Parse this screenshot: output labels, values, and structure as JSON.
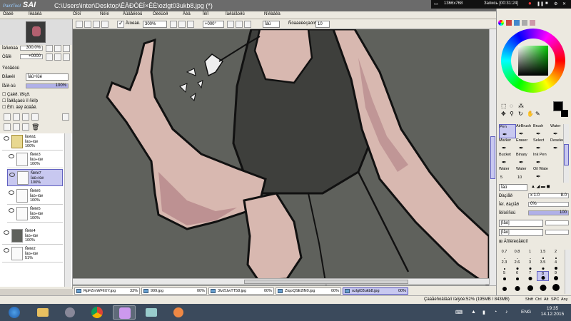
{
  "window": {
    "app_name": "PaintTool SAI",
    "title": "C:\\Users\\inter\\Desktop\\ÊÀÐÒÈÍ×ÊÈ\\ozlgt03ukb8.jpg (*)"
  },
  "recorder": {
    "resolution": "1366x768",
    "record_label": "Запись [00:31:24]"
  },
  "menu": {
    "items": [
      "Ôàéë",
      "Ïðàâêà",
      "Ôîòî",
      "Ñëîé",
      "Âûäåëèòü",
      "Ôèëüòð",
      "Âèä",
      "Îêíî",
      "Ïàðàìåòðû",
      "Ñïðàâêà"
    ]
  },
  "toolbar": {
    "checkbox_label": "Àíòèàë.",
    "zoom_value": "300%",
    "rotation_value": "+000°",
    "mode_value": "Îáû",
    "stabilizer_label": "Ñòàáèëèçàòîð",
    "stabilizer_value": "10"
  },
  "navigator": {
    "zoom_label": "Ìàñøòàá",
    "zoom_value": "300.0%",
    "angle_label": "Óãîë",
    "angle_value": "+0000"
  },
  "layer_props": {
    "header": "Ýôôåêòû",
    "mode_label": "Ðåæèì",
    "mode_value": "Îáû÷íûé",
    "opacity_label": "Íåïð-òü",
    "opacity_value": "100%",
    "checks": [
      "Çàêð. ïðîçð.",
      "Îáðåçàòü ïî ñëîþ",
      "Èñï. äëÿ âûäåë."
    ]
  },
  "layers": [
    {
      "name": "Ïàïêà1",
      "mode": "Îáû÷íûé",
      "opacity": "100%",
      "type": "folder"
    },
    {
      "name": "Ñëîé3",
      "mode": "Îáû÷íûé",
      "opacity": "100%",
      "type": "layer"
    },
    {
      "name": "Ñëîé7",
      "mode": "Îáû÷íûé",
      "opacity": "100%",
      "type": "layer"
    },
    {
      "name": "Ñëîé6",
      "mode": "Îáû÷íûé",
      "opacity": "100%",
      "type": "layer"
    },
    {
      "name": "Ñëîé5",
      "mode": "Îáû÷íûé",
      "opacity": "100%",
      "type": "layer"
    },
    {
      "name": "Ñëîé4",
      "mode": "Îáû÷íûé",
      "opacity": "100%",
      "type": "layer"
    },
    {
      "name": "Ñëîé2",
      "mode": "Îáû÷íûé",
      "opacity": "51%",
      "type": "layer"
    }
  ],
  "tabs": [
    {
      "name": "RpFZmWFlIXY.jpg",
      "pct": "33%"
    },
    {
      "name": "999.jpg",
      "pct": "00%"
    },
    {
      "name": "3lv21lwTT58.jpg",
      "pct": "00%"
    },
    {
      "name": "ZiqoQSE2lN0.jpg",
      "pct": "00%"
    },
    {
      "name": "ozlgt03ukb8.jpg",
      "pct": "00%"
    }
  ],
  "status": {
    "memory": "Çàäåéñòâîâàíî ïàìÿòè:52% (195MB / 843MB)",
    "keys": [
      "Shift",
      "Ctrl",
      "Alt",
      "SPC"
    ],
    "any": "Any"
  },
  "tools": {
    "row1": [
      {
        "label": "Pen",
        "selected": true
      },
      {
        "label": "AirBrush",
        "selected": false
      },
      {
        "label": "Brush",
        "selected": false
      },
      {
        "label": "Water",
        "selected": false
      }
    ],
    "row2": [
      {
        "label": "Marker",
        "selected": false
      },
      {
        "label": "Eraser",
        "selected": false
      },
      {
        "label": "Select",
        "selected": false
      },
      {
        "label": "Deselect",
        "selected": false
      }
    ],
    "row3": [
      {
        "label": "Bucket",
        "selected": false
      },
      {
        "label": "Binary",
        "selected": false
      },
      {
        "label": "Ink Pen",
        "selected": false
      },
      {
        "label": "",
        "selected": false
      }
    ],
    "row4": [
      {
        "label": "Water",
        "selected": false
      },
      {
        "label": "Water",
        "selected": false
      },
      {
        "label": "Oil Wate",
        "selected": false
      },
      {
        "label": "",
        "selected": false
      }
    ],
    "brush_num_1": "5",
    "brush_num_2": "10"
  },
  "brush_settings": {
    "mode_value": "Îáû",
    "size_label": "Ðàçìåð",
    "size_multiplier": "x 1.0",
    "size_value": "8.0",
    "min_size_label": "Ìèí. ðàçìåð",
    "min_size_value": "0%",
    "density_label": "Ïëîòíîñòü",
    "density_value": "100",
    "shape_value": "[Íåò]",
    "texture_value": "[Íåò]",
    "advanced_label": "Äîïîëíèòåëüíî"
  },
  "brush_sizes": {
    "row1": [
      "0.7",
      "0.8",
      "1",
      "1.5",
      "2"
    ],
    "row2": [
      "2.3",
      "2.6",
      "3",
      "3.5",
      "4"
    ],
    "row3": [
      "5",
      "6",
      "7",
      "8",
      "9"
    ],
    "row4": [
      "",
      "",
      "",
      "",
      ""
    ],
    "selected": "8"
  },
  "taskbar": {
    "lang": "ENG",
    "time": "19:35",
    "date": "14.12.2015"
  },
  "colors": {
    "canvas_bg": "#5f615c",
    "skin": "#d8b8b0",
    "skin_shadow": "#b7878b",
    "top": "#3e3f3c",
    "selection": "#c8c8f0",
    "taskbar": "#3b4a5c"
  }
}
